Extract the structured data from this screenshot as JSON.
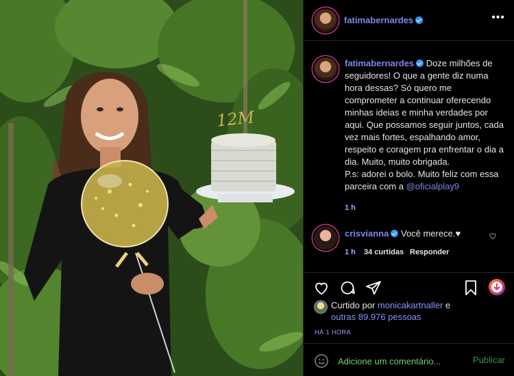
{
  "post": {
    "author": "fatimabernardes",
    "caption_text": "Doze milhões de seguidores! O que a gente diz numa hora dessas? Só quero me comprometer a continuar oferecendo minhas ideias e minha verdades por aqui. Que possamos seguir juntos, cada vez mais fortes, espalhando amor, respeito e coragem pra enfrentar o dia a dia. Muito, muito obrigada.",
    "caption_ps": "P.s: adorei o bolo. Muito feliz com essa parceira com a ",
    "caption_mention": "@oficialplay9",
    "caption_time": "1 h",
    "cake_topper": "12M"
  },
  "comment": {
    "author": "crisvianna",
    "text": "Você merece.♥",
    "time": "1 h",
    "likes": "34 curtidas",
    "reply_label": "Responder"
  },
  "likes": {
    "prefix": "Curtido por ",
    "user": "monicakartnaller",
    "joiner": " e",
    "others": "outras 89.976 pessoas",
    "time_ago": "HÁ 1 HORA"
  },
  "comment_box": {
    "placeholder": "Adicione um comentário...",
    "publish_label": "Publicar"
  },
  "icons": [
    "more-icon",
    "heart-icon",
    "comment-icon",
    "share-icon",
    "bookmark-icon",
    "download-icon",
    "emoji-icon"
  ],
  "colors": {
    "link": "#7e86e8",
    "accent": "#3897f0",
    "input": "#6fcf6f"
  }
}
